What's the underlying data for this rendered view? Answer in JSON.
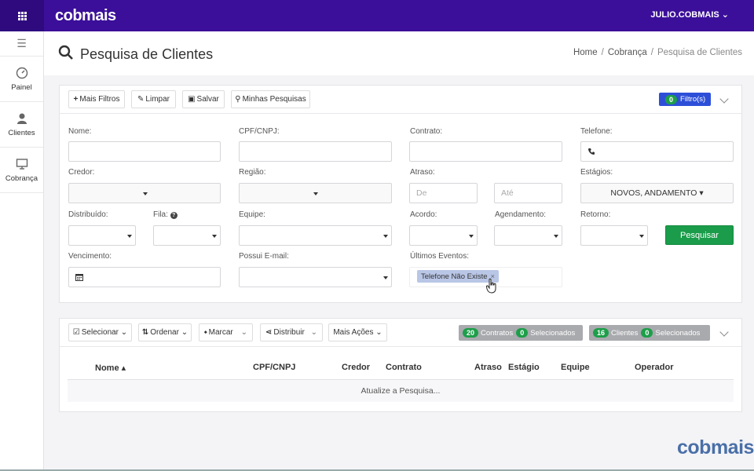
{
  "topbar": {
    "brand": "cobmais",
    "user": "JULIO.COBMAIS ⌄"
  },
  "sidebar": {
    "items": [
      {
        "label": "Painel"
      },
      {
        "label": "Clientes"
      },
      {
        "label": "Cobrança"
      }
    ]
  },
  "header": {
    "title": "Pesquisa de Clientes",
    "breadcrumb": [
      "Home",
      "Cobrança",
      "Pesquisa de Clientes"
    ]
  },
  "filters_toolbar": {
    "mais_filtros": "Mais Filtros",
    "limpar": "Limpar",
    "salvar": "Salvar",
    "minhas_pesquisas": "Minhas Pesquisas",
    "filter_count": "0",
    "filter_label": "Filtro(s)"
  },
  "form": {
    "nome": "Nome:",
    "cpf": "CPF/CNPJ:",
    "contrato": "Contrato:",
    "telefone": "Telefone:",
    "credor": "Credor:",
    "regiao": "Região:",
    "atraso": "Atraso:",
    "atraso_de": "De",
    "atraso_ate": "Até",
    "estagios": "Estágios:",
    "estagios_value": "NOVOS, ANDAMENTO ▾",
    "distribuido": "Distribuído:",
    "fila": "Fila:",
    "equipe": "Equipe:",
    "acordo": "Acordo:",
    "agendamento": "Agendamento:",
    "retorno": "Retorno:",
    "pesquisar": "Pesquisar",
    "vencimento": "Vencimento:",
    "possui_email": "Possui E-mail:",
    "ultimos_eventos": "Últimos Eventos:",
    "evento_tag": "Telefone Não Existe",
    "evento_tag_close": "×"
  },
  "results_toolbar": {
    "selecionar": "Selecionar ⌄",
    "ordenar": "Ordenar ⌄",
    "marcar": "Marcar",
    "distribuir": "Distribuir",
    "mais_acoes": "Mais Ações ⌄",
    "contratos_count": "20",
    "contratos_label": "Contratos",
    "contratos_sel_count": "0",
    "contratos_sel_label": "Selecionados",
    "clientes_count": "16",
    "clientes_label": "Clientes",
    "clientes_sel_count": "0",
    "clientes_sel_label": "Selecionados"
  },
  "table": {
    "columns": [
      "Nome ▴",
      "CPF/CNPJ",
      "Credor",
      "Contrato",
      "Atraso",
      "Estágio",
      "Equipe",
      "Operador"
    ],
    "empty_message": "Atualize a Pesquisa..."
  },
  "footer": {
    "logo": "cobmais"
  },
  "colors": {
    "topbar": "#3b0f99",
    "search_button": "#1a9c4a",
    "filter_badge": "#2d4fd8",
    "pill": "#1e9e4a"
  }
}
